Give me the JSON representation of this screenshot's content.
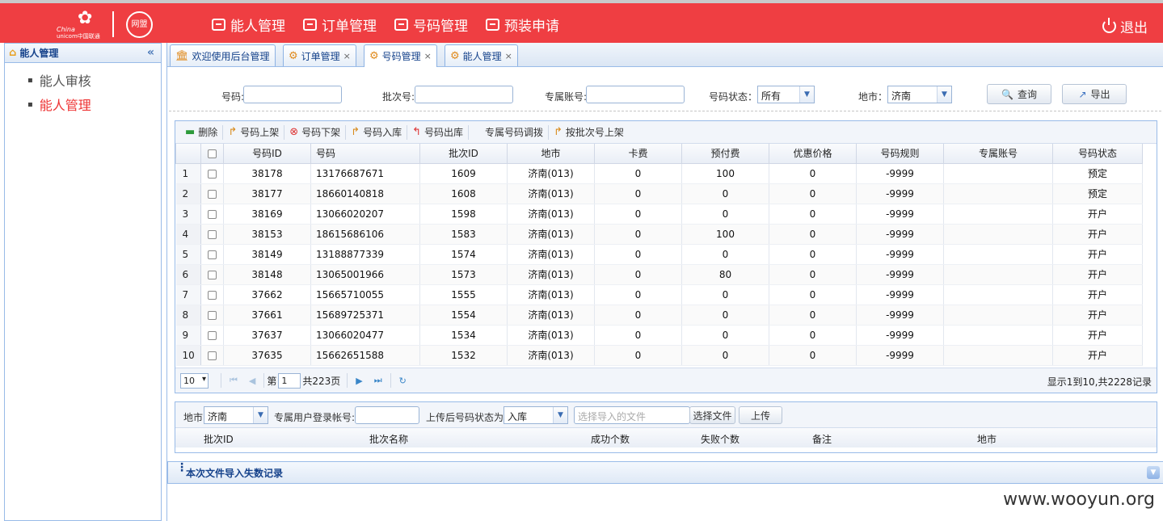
{
  "brand": {
    "china": "China",
    "unicom": "unicom中国联通",
    "wangmeng": "网盟"
  },
  "topnav": [
    {
      "label": "能人管理"
    },
    {
      "label": "订单管理"
    },
    {
      "label": "号码管理"
    },
    {
      "label": "预装申请"
    }
  ],
  "logout": "退出",
  "sidebar": {
    "title": "能人管理",
    "collapse": "«",
    "items": [
      {
        "label": "能人审核",
        "active": false
      },
      {
        "label": "能人管理",
        "active": true
      }
    ]
  },
  "tabs": [
    {
      "label": "欢迎使用后台管理",
      "closable": false
    },
    {
      "label": "订单管理",
      "closable": true
    },
    {
      "label": "号码管理",
      "closable": true,
      "active": true
    },
    {
      "label": "能人管理",
      "closable": true
    }
  ],
  "search": {
    "number_label": "号码:",
    "batch_label": "批次号:",
    "account_label": "专属账号:",
    "status_label": "号码状态：",
    "status_value": "所有",
    "city_label": "地市：",
    "city_value": "济南",
    "query_button": "查询",
    "export_button": "导出"
  },
  "toolbar": [
    {
      "label": "删除",
      "icon": "delete-icon"
    },
    {
      "label": "号码上架",
      "icon": "shelve-icon"
    },
    {
      "label": "号码下架",
      "icon": "unshelve-icon"
    },
    {
      "label": "号码入库",
      "icon": "stock-in-icon"
    },
    {
      "label": "号码出库",
      "icon": "stock-out-icon"
    },
    {
      "label": "专属号码调拨",
      "icon": ""
    },
    {
      "label": "按批次号上架",
      "icon": "batch-shelve-icon"
    }
  ],
  "columns": [
    "号码ID",
    "号码",
    "批次ID",
    "地市",
    "卡费",
    "预付费",
    "优惠价格",
    "号码规则",
    "专属账号",
    "号码状态"
  ],
  "rows": [
    [
      "1",
      "38178",
      "13176687671",
      "1609",
      "济南(013)",
      "0",
      "100",
      "0",
      "-9999",
      "",
      "预定"
    ],
    [
      "2",
      "38177",
      "18660140818",
      "1608",
      "济南(013)",
      "0",
      "0",
      "0",
      "-9999",
      "",
      "预定"
    ],
    [
      "3",
      "38169",
      "13066020207",
      "1598",
      "济南(013)",
      "0",
      "0",
      "0",
      "-9999",
      "",
      "开户"
    ],
    [
      "4",
      "38153",
      "18615686106",
      "1583",
      "济南(013)",
      "0",
      "100",
      "0",
      "-9999",
      "",
      "开户"
    ],
    [
      "5",
      "38149",
      "13188877339",
      "1574",
      "济南(013)",
      "0",
      "0",
      "0",
      "-9999",
      "",
      "开户"
    ],
    [
      "6",
      "38148",
      "13065001966",
      "1573",
      "济南(013)",
      "0",
      "80",
      "0",
      "-9999",
      "",
      "开户"
    ],
    [
      "7",
      "37662",
      "15665710055",
      "1555",
      "济南(013)",
      "0",
      "0",
      "0",
      "-9999",
      "",
      "开户"
    ],
    [
      "8",
      "37661",
      "15689725371",
      "1554",
      "济南(013)",
      "0",
      "0",
      "0",
      "-9999",
      "",
      "开户"
    ],
    [
      "9",
      "37637",
      "13066020477",
      "1534",
      "济南(013)",
      "0",
      "0",
      "0",
      "-9999",
      "",
      "开户"
    ],
    [
      "10",
      "37635",
      "15662651588",
      "1532",
      "济南(013)",
      "0",
      "0",
      "0",
      "-9999",
      "",
      "开户"
    ]
  ],
  "pager": {
    "page_size": "10",
    "page_prefix": "第",
    "page_value": "1",
    "page_suffix": "共223页",
    "info": "显示1到10,共2228记录"
  },
  "upload": {
    "city_label": "地市",
    "city_value": "济南",
    "account_label": "专属用户登录帐号:",
    "status_label": "上传后号码状态为",
    "status_value": "入库",
    "file_placeholder": "选择导入的文件",
    "choose_button": "选择文件",
    "upload_button": "上传",
    "columns": [
      "批次ID",
      "批次名称",
      "成功个数",
      "失败个数",
      "备注",
      "地市"
    ]
  },
  "fail_panel": {
    "title": "本次文件导入失数记录"
  },
  "watermark": "www.wooyun.org",
  "colors": {
    "topbar": "#ef3e42",
    "accent": "#99bbe8",
    "active": "#ee3333"
  }
}
